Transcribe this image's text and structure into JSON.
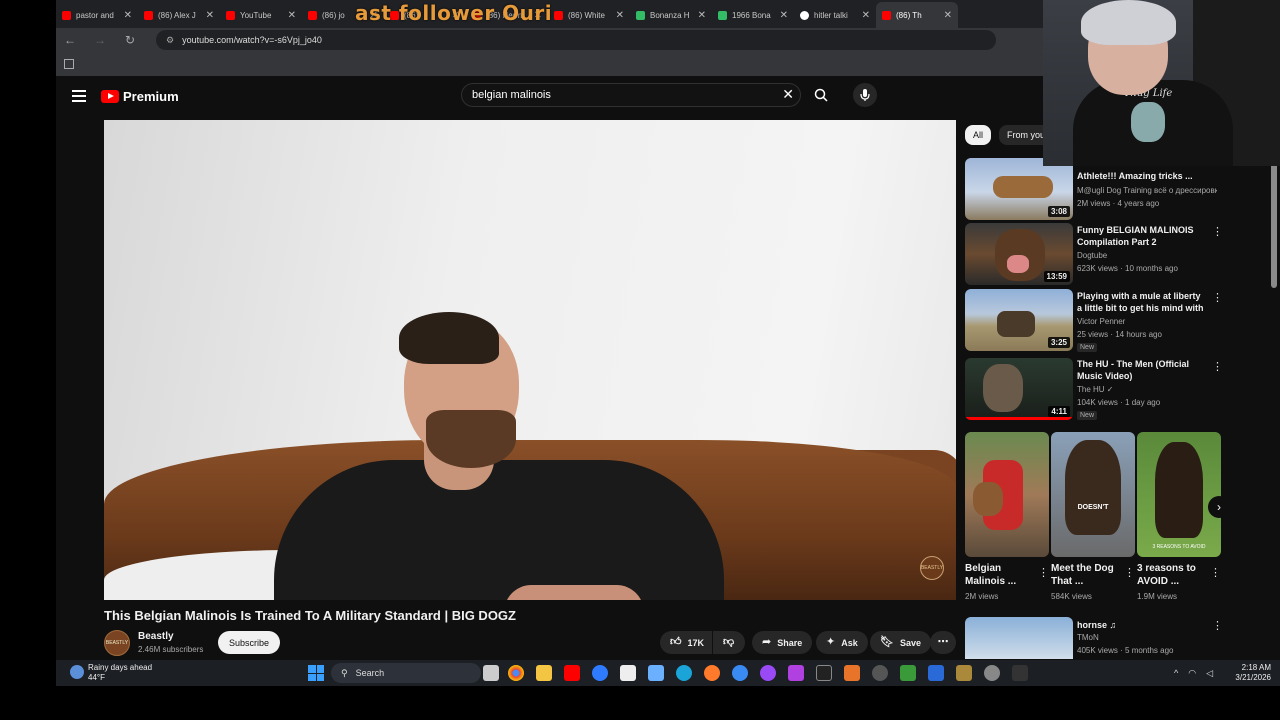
{
  "browser": {
    "tabs": [
      {
        "title": "pastor and",
        "favicon": "youtube"
      },
      {
        "title": "(86) Alex J",
        "favicon": "youtube"
      },
      {
        "title": "YouTube",
        "favicon": "youtube"
      },
      {
        "title": "(86) jo",
        "favicon": "youtube"
      },
      {
        "title": "(86) ",
        "favicon": "youtube"
      },
      {
        "title": "(86) Herm",
        "favicon": "youtube"
      },
      {
        "title": "(86) White",
        "favicon": "youtube"
      },
      {
        "title": "Bonanza H",
        "favicon": "bonanza"
      },
      {
        "title": "1966 Bona",
        "favicon": "bonanza"
      },
      {
        "title": "hitler talki",
        "favicon": "google"
      },
      {
        "title": "(86) Th",
        "favicon": "youtube",
        "active": true
      }
    ],
    "overlay_text": "ast follower Ouri",
    "url": "youtube.com/watch?v=-s6Vpj_jo40"
  },
  "youtube": {
    "logo_text": "Premium",
    "search_query": "belgian malinois",
    "video": {
      "title": "This Belgian Malinois Is Trained To A Military Standard | BIG DOGZ",
      "watermark": "BEASTLY",
      "channel_name": "Beastly",
      "channel_avatar_text": "BEASTLY",
      "subscribers": "2.46M subscribers",
      "subscribe_label": "Subscribe",
      "likes": "17K",
      "share_label": "Share",
      "ask_label": "Ask",
      "save_label": "Save"
    },
    "chips": [
      {
        "label": "All",
        "active": true
      },
      {
        "label": "From your",
        "active": false
      }
    ],
    "recommendations": [
      {
        "title": "Athlete!!! Amazing tricks ...",
        "channel": "M@ugli Dog Training всё о дрессировк...",
        "meta": "2M views · 4 years ago",
        "duration": "3:08",
        "new": ""
      },
      {
        "title": "Funny BELGIAN MALINOIS Compilation Part 2",
        "channel": "Dogtube",
        "meta": "623K views · 10 months ago",
        "duration": "13:59",
        "new": ""
      },
      {
        "title": "Playing with a mule at liberty a little bit to get his mind with m...",
        "channel": "Victor Penner",
        "meta": "25 views · 14 hours ago",
        "duration": "3:25",
        "new": "New"
      },
      {
        "title": "The HU - The Men (Official Music Video)",
        "channel": "The HU",
        "meta": "104K views · 1 day ago",
        "duration": "4:11",
        "new": "New"
      }
    ],
    "shorts": [
      {
        "title": "Belgian Malinois ...",
        "views": "2M views",
        "thumb_text": ""
      },
      {
        "title": "Meet the Dog That ...",
        "views": "584K views",
        "thumb_text": "DOESN'T"
      },
      {
        "title": "3 reasons to AVOID ...",
        "views": "1.9M views",
        "thumb_text": "3 REASONS TO AVOID"
      }
    ],
    "last_rec": {
      "title": "hornse ♫",
      "channel": "TMoN",
      "meta": "405K views · 5 months ago"
    }
  },
  "webcam": {
    "shirt_text": "Thug Life"
  },
  "taskbar": {
    "weather_line1": "Rainy days ahead",
    "weather_line2": "44°F",
    "search_label": "Search",
    "time": "2:18 AM",
    "date": "3/21/2026"
  },
  "colors": {
    "youtube_red": "#ff0000",
    "bg": "#0f0f0f",
    "accent_orange": "#e69a3a"
  }
}
